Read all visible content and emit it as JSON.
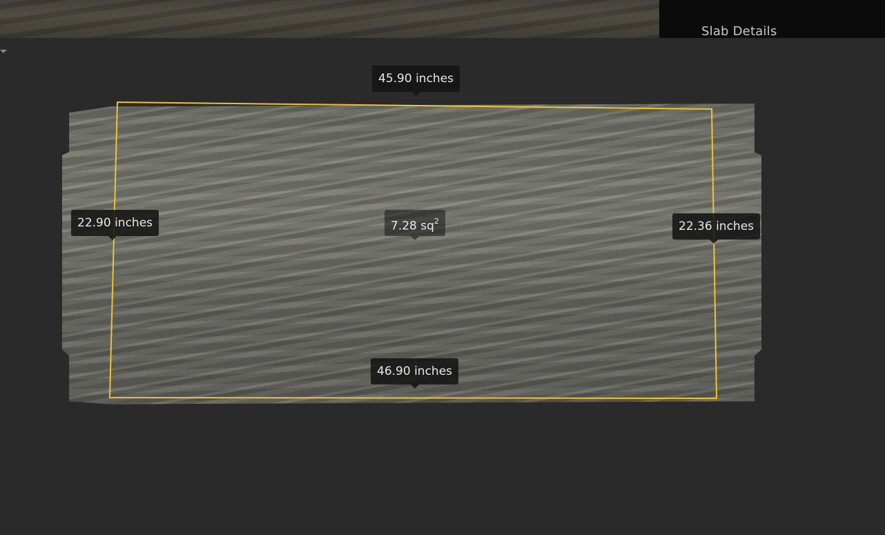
{
  "panel": {
    "title": "Slab Details"
  },
  "measurements": {
    "top": "45.90 inches",
    "bottom": "46.90 inches",
    "left": "22.90 inches",
    "right": "22.36 inches",
    "area_value": "7.28 sq",
    "area_exp": "2"
  },
  "colors": {
    "outline": "#f2c230",
    "background": "#2a2a2a",
    "panel": "#0b0b0b"
  }
}
